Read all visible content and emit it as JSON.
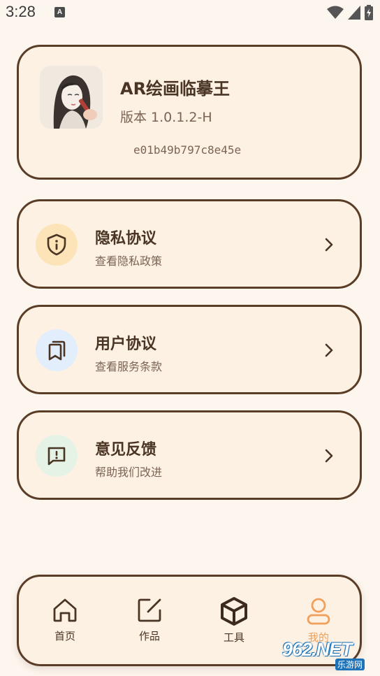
{
  "status_bar": {
    "time": "3:28",
    "notification_letter": "A"
  },
  "app_info": {
    "name": "AR绘画临摹王",
    "version": "版本 1.0.1.2-H",
    "hash": "e01b49b797c8e45e"
  },
  "menu": [
    {
      "title": "隐私协议",
      "subtitle": "查看隐私政策",
      "icon": "shield-info-icon",
      "icon_bg": "#fde4b8"
    },
    {
      "title": "用户协议",
      "subtitle": "查看服务条款",
      "icon": "document-copy-icon",
      "icon_bg": "#e2eefb"
    },
    {
      "title": "意见反馈",
      "subtitle": "帮助我们改进",
      "icon": "feedback-message-icon",
      "icon_bg": "#e4f3e6"
    }
  ],
  "bottom_nav": [
    {
      "label": "首页",
      "icon": "home-icon",
      "active": false
    },
    {
      "label": "作品",
      "icon": "edit-icon",
      "active": false
    },
    {
      "label": "工具",
      "icon": "cube-icon",
      "active": false
    },
    {
      "label": "我的",
      "icon": "user-icon",
      "active": true
    }
  ],
  "watermark": {
    "brand": "962.NET",
    "sub": "乐游网"
  },
  "colors": {
    "accent": "#f0a05a",
    "border": "#5a3d27",
    "card_bg": "#fdf1e3",
    "page_bg": "#fdf6ee"
  }
}
